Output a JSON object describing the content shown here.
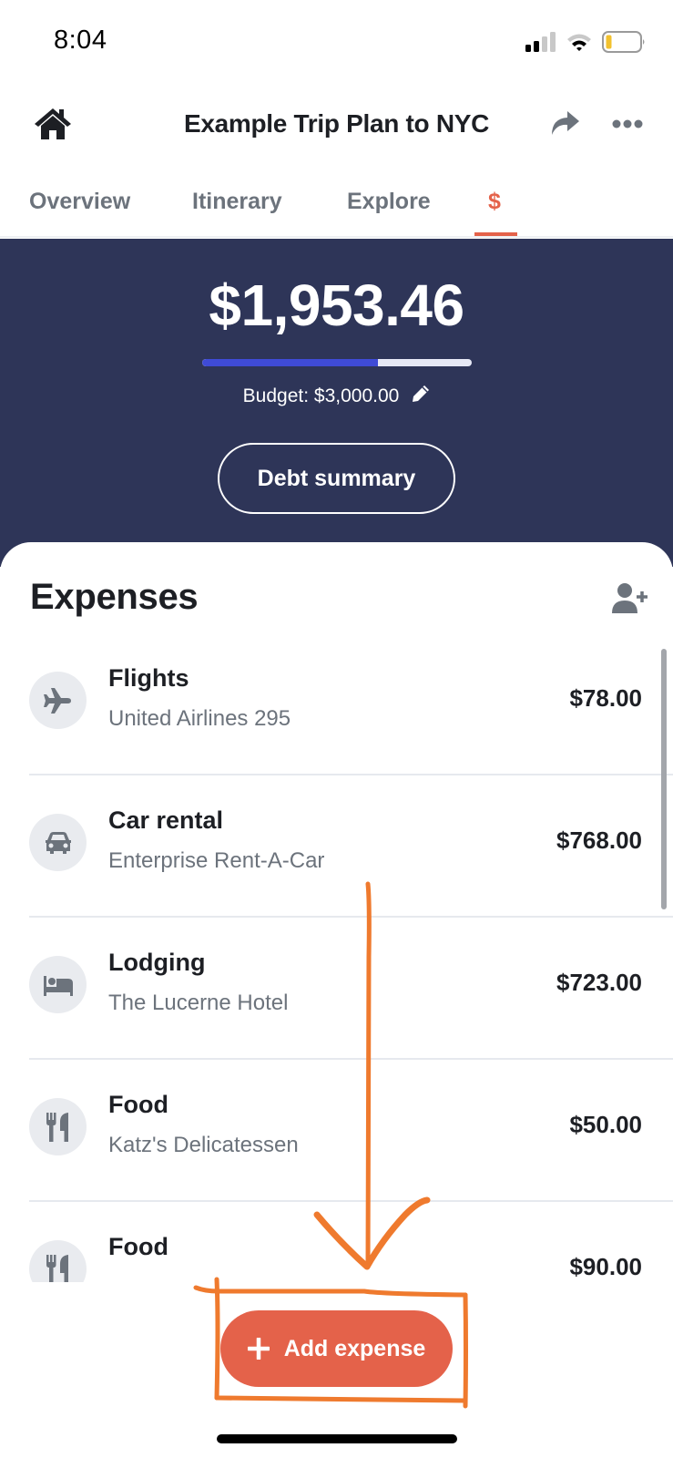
{
  "status_bar": {
    "time": "8:04",
    "icons": [
      "cellular-signal-icon",
      "wifi-icon",
      "battery-low-icon"
    ],
    "battery_color": "#f2c12e"
  },
  "header": {
    "title": "Example Trip Plan to NYC",
    "left_icon": "home-icon",
    "right_icons": [
      "share-icon",
      "more-options-icon"
    ]
  },
  "tabs": [
    {
      "label": "Overview",
      "active": false
    },
    {
      "label": "Itinerary",
      "active": false
    },
    {
      "label": "Explore",
      "active": false
    },
    {
      "label": "$",
      "active": true
    }
  ],
  "summary": {
    "total": "$1,953.46",
    "budget_label": "Budget: $3,000.00",
    "budget_progress_percent": 65.1,
    "edit_icon": "pencil-icon",
    "debt_button": "Debt summary"
  },
  "expenses": {
    "title": "Expenses",
    "add_person_icon": "user-plus-icon",
    "items": [
      {
        "icon": "plane-icon",
        "title": "Flights",
        "subtitle": "United Airlines 295",
        "amount": "$78.00"
      },
      {
        "icon": "car-icon",
        "title": "Car rental",
        "subtitle": "Enterprise Rent-A-Car",
        "amount": "$768.00"
      },
      {
        "icon": "bed-icon",
        "title": "Lodging",
        "subtitle": "The Lucerne Hotel",
        "amount": "$723.00"
      },
      {
        "icon": "utensils-icon",
        "title": "Food",
        "subtitle": "Katz's Delicatessen",
        "amount": "$50.00"
      },
      {
        "icon": "utensils-icon",
        "title": "Food",
        "subtitle": "",
        "amount": "$90.00"
      }
    ]
  },
  "add_expense": {
    "label": "Add expense",
    "icon": "plus-icon"
  },
  "colors": {
    "accent": "#e4624a",
    "summary_bg": "#2e3558",
    "progress_fill": "#3f4bd6",
    "annotation": "#ef7a2e"
  }
}
